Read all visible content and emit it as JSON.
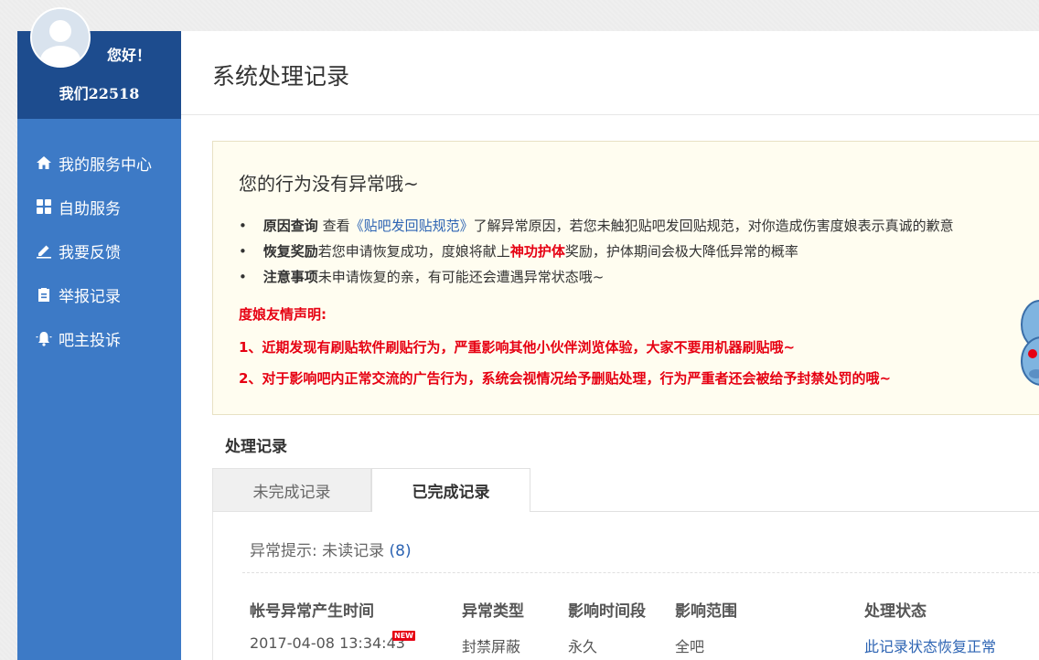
{
  "sidebar": {
    "greeting": "您好！",
    "username": "我们22518",
    "items": [
      {
        "label": "我的服务中心",
        "icon": "home-icon"
      },
      {
        "label": "自助服务",
        "icon": "grid-icon"
      },
      {
        "label": "我要反馈",
        "icon": "edit-icon"
      },
      {
        "label": "举报记录",
        "icon": "clipboard-icon"
      },
      {
        "label": "吧主投诉",
        "icon": "bell-icon"
      }
    ]
  },
  "main": {
    "title": "系统处理记录",
    "notice": {
      "title": "您的行为没有异常哦~",
      "reason_label": "原因查询",
      "reason_pre": " 查看",
      "reason_link": "《贴吧发回贴规范》",
      "reason_post": "了解异常原因，若您未触犯贴吧发回贴规范，对你造成伤害度娘表示真诚的歉意",
      "reward_label": "恢复奖励",
      "reward_pre": "若您申请恢复成功，度娘将献上",
      "reward_highlight": "神功护体",
      "reward_post": "奖励，护体期间会极大降低异常的概率",
      "caution_label": "注意事项",
      "caution_text": "未申请恢复的亲，有可能还会遭遇异常状态哦~",
      "statement_title": "度娘友情声明:",
      "statement_1": "1、近期发现有刷贴软件刷贴行为，严重影响其他小伙伴浏览体验，大家不要用机器刷贴哦~",
      "statement_2": "2、对于影响吧内正常交流的广告行为，系统会视情况给予删贴处理，行为严重者还会被给予封禁处罚的哦~"
    },
    "records_heading": "处理记录",
    "tabs": [
      {
        "label": "未完成记录",
        "active": false
      },
      {
        "label": "已完成记录",
        "active": true
      }
    ],
    "hint_label": "异常提示:  未读记录",
    "hint_count": "(8)",
    "table": {
      "headers": [
        "帐号异常产生时间",
        "异常类型",
        "影响时间段",
        "影响范围",
        "处理状态"
      ],
      "rows": [
        {
          "time": "2017-04-08 13:34:43",
          "badge": "NEW",
          "type": "封禁屏蔽",
          "period": "永久",
          "scope": "全吧",
          "status": "此记录状态恢复正常"
        }
      ]
    }
  },
  "colors": {
    "sidebar": "#3d7ac6",
    "sidebar_header": "#1d4c8e",
    "accent_red": "#e60012",
    "link_blue": "#2d64b3",
    "notice_bg": "#fffdf0"
  }
}
